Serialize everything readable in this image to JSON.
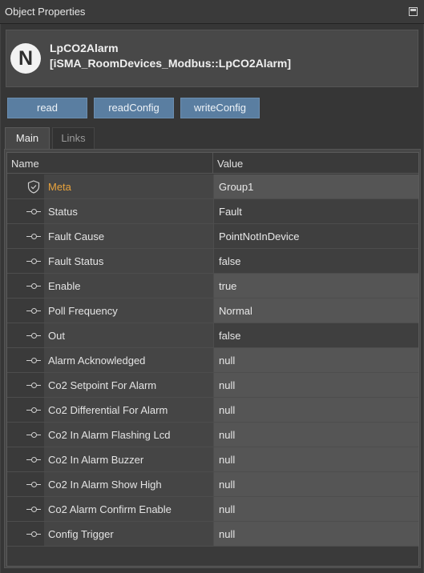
{
  "window": {
    "title": "Object Properties"
  },
  "object": {
    "logo_letter": "N",
    "name": "LpCO2Alarm",
    "type": "[iSMA_RoomDevices_Modbus::LpCO2Alarm]"
  },
  "actions": {
    "read": "read",
    "read_config": "readConfig",
    "write_config": "writeConfig"
  },
  "tabs": {
    "main": "Main",
    "links": "Links"
  },
  "table": {
    "col_name": "Name",
    "col_value": "Value",
    "rows": [
      {
        "name": "Meta",
        "value": "Group1",
        "icon": "shield-icon"
      },
      {
        "name": "Status",
        "value": "Fault",
        "icon": "slot-icon"
      },
      {
        "name": "Fault Cause",
        "value": "PointNotInDevice",
        "icon": "slot-icon"
      },
      {
        "name": "Fault Status",
        "value": "false",
        "icon": "slot-icon"
      },
      {
        "name": "Enable",
        "value": "true",
        "icon": "slot-icon"
      },
      {
        "name": "Poll Frequency",
        "value": "Normal",
        "icon": "slot-icon"
      },
      {
        "name": "Out",
        "value": "false",
        "icon": "slot-icon"
      },
      {
        "name": "Alarm Acknowledged",
        "value": "null",
        "icon": "slot-icon"
      },
      {
        "name": "Co2 Setpoint For Alarm",
        "value": "null",
        "icon": "slot-icon"
      },
      {
        "name": "Co2 Differential For Alarm",
        "value": "null",
        "icon": "slot-icon"
      },
      {
        "name": "Co2 In Alarm Flashing Lcd",
        "value": "null",
        "icon": "slot-icon"
      },
      {
        "name": "Co2 In Alarm Buzzer",
        "value": "null",
        "icon": "slot-icon"
      },
      {
        "name": "Co2 In Alarm Show High",
        "value": "null",
        "icon": "slot-icon"
      },
      {
        "name": "Co2 Alarm Confirm Enable",
        "value": "null",
        "icon": "slot-icon"
      },
      {
        "name": "Config Trigger",
        "value": "null",
        "icon": "slot-icon"
      }
    ]
  },
  "colors": {
    "accent_button": "#5a7ea1",
    "meta_label": "#e8a33c",
    "background": "#2b2b2b"
  }
}
